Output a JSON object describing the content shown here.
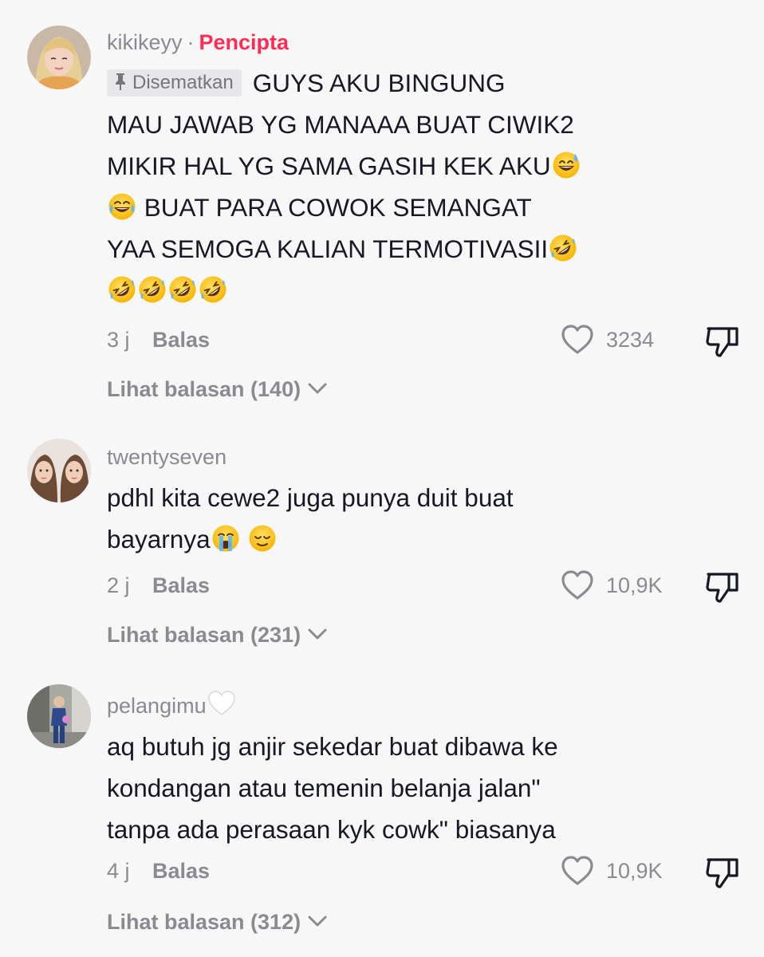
{
  "comments": [
    {
      "username": "kikikeyy",
      "separator": "·",
      "creator_badge": "Pencipta",
      "pinned_label": "Disematkan",
      "lines": [
        "GUYS AKU BINGUNG",
        "MAU JAWAB YG MANAAA BUAT CIWIK2",
        "MIKIR HAL YG SAMA GASIH KEK AKU",
        "BUAT PARA COWOK SEMANGAT",
        "YAA SEMOGA KALIAN TERMOTIVASII"
      ],
      "time": "3 j",
      "reply_label": "Balas",
      "likes": "3234",
      "view_replies": "Lihat balasan (140)"
    },
    {
      "username": "twentyseven",
      "lines": [
        "pdhl kita cewe2 juga punya duit buat",
        "bayarnya"
      ],
      "time": "2 j",
      "reply_label": "Balas",
      "likes": "10,9K",
      "view_replies": "Lihat balasan (231)"
    },
    {
      "username": "pelangimu",
      "lines": [
        "aq butuh jg anjir sekedar buat dibawa ke",
        "kondangan atau temenin belanja jalan\"",
        "tanpa ada perasaan kyk cowk\" biasanya"
      ],
      "time": "4 j",
      "reply_label": "Balas",
      "likes": "10,9K",
      "view_replies": "Lihat balasan (312)"
    }
  ],
  "colors": {
    "background": "#f7f7f7",
    "text": "#161823",
    "muted": "#8a8b91",
    "creator": "#fe2c55"
  },
  "icons": [
    "pin-icon",
    "heart-outline-icon",
    "thumbs-down-icon",
    "chevron-down-icon",
    "white-heart-emoji",
    "sweat-smile-emoji",
    "joy-emoji",
    "rofl-emoji",
    "loudly-crying-emoji",
    "relieved-emoji"
  ]
}
